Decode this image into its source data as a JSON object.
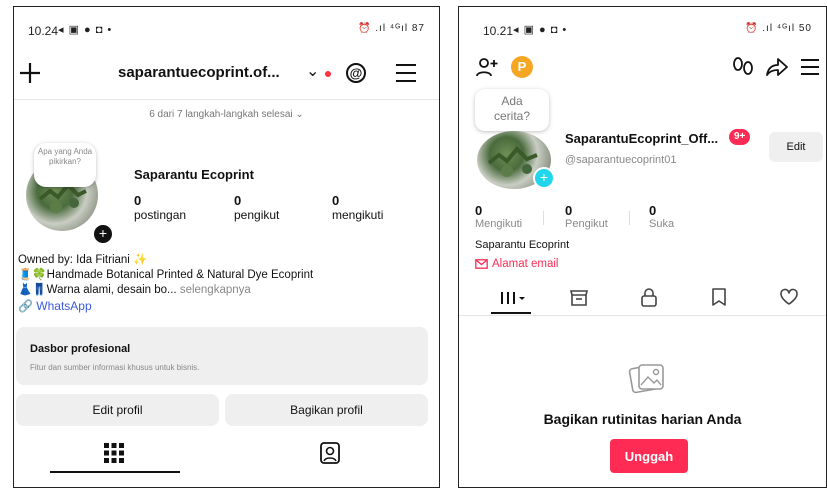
{
  "instagram": {
    "status_time": "10.24",
    "status_icons": "◂ ▣ ● ◘ •",
    "status_right": "⏰ .ıl ⁴ᴳıl 87",
    "username": "saparantuecoprint.of...",
    "chevron": "⌄",
    "progress_text": "6 dari 7 langkah-langkah selesai",
    "note_bubble": "Apa yang Anda pikirkan?",
    "display_name": "Saparantu Ecoprint",
    "stats": [
      {
        "value": "0",
        "label": "postingan"
      },
      {
        "value": "0",
        "label": "pengikut"
      },
      {
        "value": "0",
        "label": "mengikuti"
      }
    ],
    "bio": [
      "Owned by: Ida Fitriani ✨",
      "🧵🍀Handmade Botanical Printed & Natural Dye Ecoprint",
      "👗👖Warna alami, desain bo..."
    ],
    "bio_more": "selengkapnya",
    "link": "WhatsApp",
    "dashboard_title": "Dasbor profesional",
    "dashboard_sub": "Fitur dan sumber informasi khusus untuk bisnis.",
    "edit_button": "Edit profil",
    "share_button": "Bagikan profil",
    "icons": {
      "plus": "plus-icon",
      "threads": "threads-icon",
      "menu": "menu-icon",
      "grid": "grid-icon",
      "tagged": "tagged-icon"
    }
  },
  "tiktok": {
    "status_time": "10.21",
    "status_icons": "◂ ▣ ● ◘ •",
    "status_right": "⏰ .ıl ⁴ᴳıl 50",
    "coin": "P",
    "note_bubble": "Ada cerita?",
    "username": "SaparantuEcoprint_Off...",
    "badge": "9+",
    "handle": "@saparantuecoprint01",
    "edit_button": "Edit",
    "stats": [
      {
        "value": "0",
        "label": "Mengikuti"
      },
      {
        "value": "0",
        "label": "Pengikut"
      },
      {
        "value": "0",
        "label": "Suka"
      }
    ],
    "display_name": "Saparantu Ecoprint",
    "email_label": "Alamat email",
    "empty_title": "Bagikan rutinitas harian Anda",
    "upload_button": "Unggah",
    "accent": "#fe2c55"
  }
}
